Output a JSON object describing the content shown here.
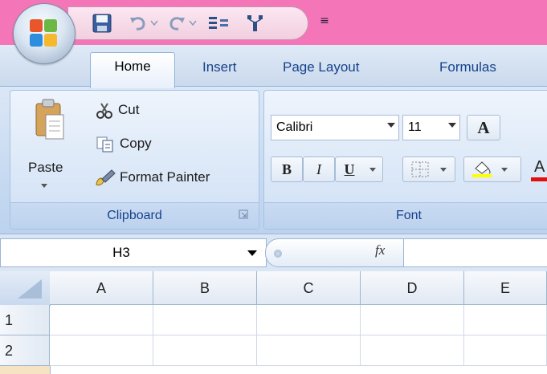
{
  "tabs": {
    "home": "Home",
    "insert": "Insert",
    "page_layout": "Page Layout",
    "formulas": "Formulas"
  },
  "clipboard": {
    "paste": "Paste",
    "cut": "Cut",
    "copy": "Copy",
    "format_painter": "Format Painter",
    "group_label": "Clipboard"
  },
  "font": {
    "family": "Calibri",
    "size": "11",
    "group_label": "Font",
    "bold": "B",
    "italic": "I",
    "underline": "U",
    "grow": "A",
    "font_color": "A"
  },
  "formula_bar": {
    "name_box": "H3",
    "fx": "fx"
  },
  "grid": {
    "columns": [
      "A",
      "B",
      "C",
      "D",
      "E"
    ],
    "rows": [
      "1",
      "2"
    ]
  },
  "colors": {
    "title_bar": "#f476b9",
    "ribbon": "#c7daf1",
    "tab_text": "#15428b"
  },
  "icons": {
    "office_button": "office-logo-icon",
    "save": "save-icon",
    "undo": "undo-icon",
    "redo": "redo-icon",
    "paste": "clipboard-icon",
    "cut": "scissors-icon",
    "copy": "copy-icon",
    "format_painter": "paintbrush-icon"
  }
}
